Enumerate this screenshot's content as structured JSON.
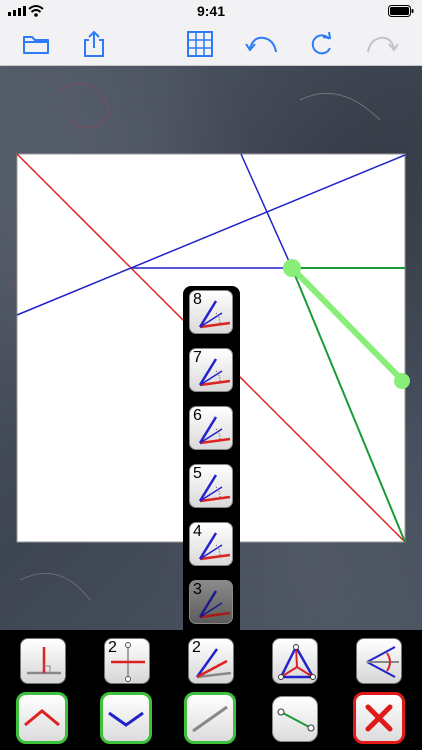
{
  "status_bar": {
    "time": "9:41"
  },
  "toolbar": {
    "items": [
      {
        "name": "folder-icon"
      },
      {
        "name": "share-icon"
      },
      {
        "name": "grid-icon"
      },
      {
        "name": "undo-icon"
      },
      {
        "name": "redo-icon"
      },
      {
        "name": "redo-disabled-icon"
      }
    ],
    "accent": "#2f7bf5"
  },
  "colors": {
    "valley": "#2222cc",
    "mountain": "#dd2222",
    "aux": "#1a9a3a",
    "highlight": "#88ee77",
    "cancel": "#e01919",
    "selected_border": "#3ec23e"
  },
  "palette": {
    "items": [
      {
        "label": "8"
      },
      {
        "label": "7"
      },
      {
        "label": "6"
      },
      {
        "label": "5"
      },
      {
        "label": "4"
      },
      {
        "label": "3"
      }
    ]
  },
  "tools": {
    "row1": [
      {
        "name": "perpendicular-tool",
        "label": ""
      },
      {
        "name": "bisect-segment-tool",
        "label": "2"
      },
      {
        "name": "bisect-angle-tool",
        "label": "2"
      },
      {
        "name": "incenter-tool",
        "label": ""
      },
      {
        "name": "angle-bisect-ray-tool",
        "label": ""
      }
    ]
  }
}
